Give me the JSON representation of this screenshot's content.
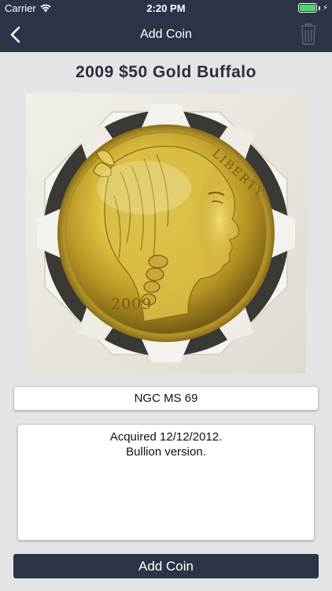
{
  "status_bar": {
    "carrier": "Carrier",
    "time": "2:20 PM",
    "battery_level": 1.0,
    "battery_color": "#4cd964"
  },
  "nav": {
    "title": "Add Coin",
    "back_icon": "chevron-left-icon",
    "trash_icon": "trash-icon"
  },
  "coin": {
    "title": "2009 $50 Gold Buffalo",
    "photo_inscriptions": {
      "liberty": "LIBERTY",
      "year": "2009"
    },
    "grade": "NGC MS 69",
    "notes": [
      "Acquired 12/12/2012.",
      "Bullion version."
    ]
  },
  "actions": {
    "add_label": "Add Coin"
  },
  "colors": {
    "nav_background": "#2c3547",
    "page_background": "#e4e4e6",
    "button_background": "#2c3547"
  }
}
